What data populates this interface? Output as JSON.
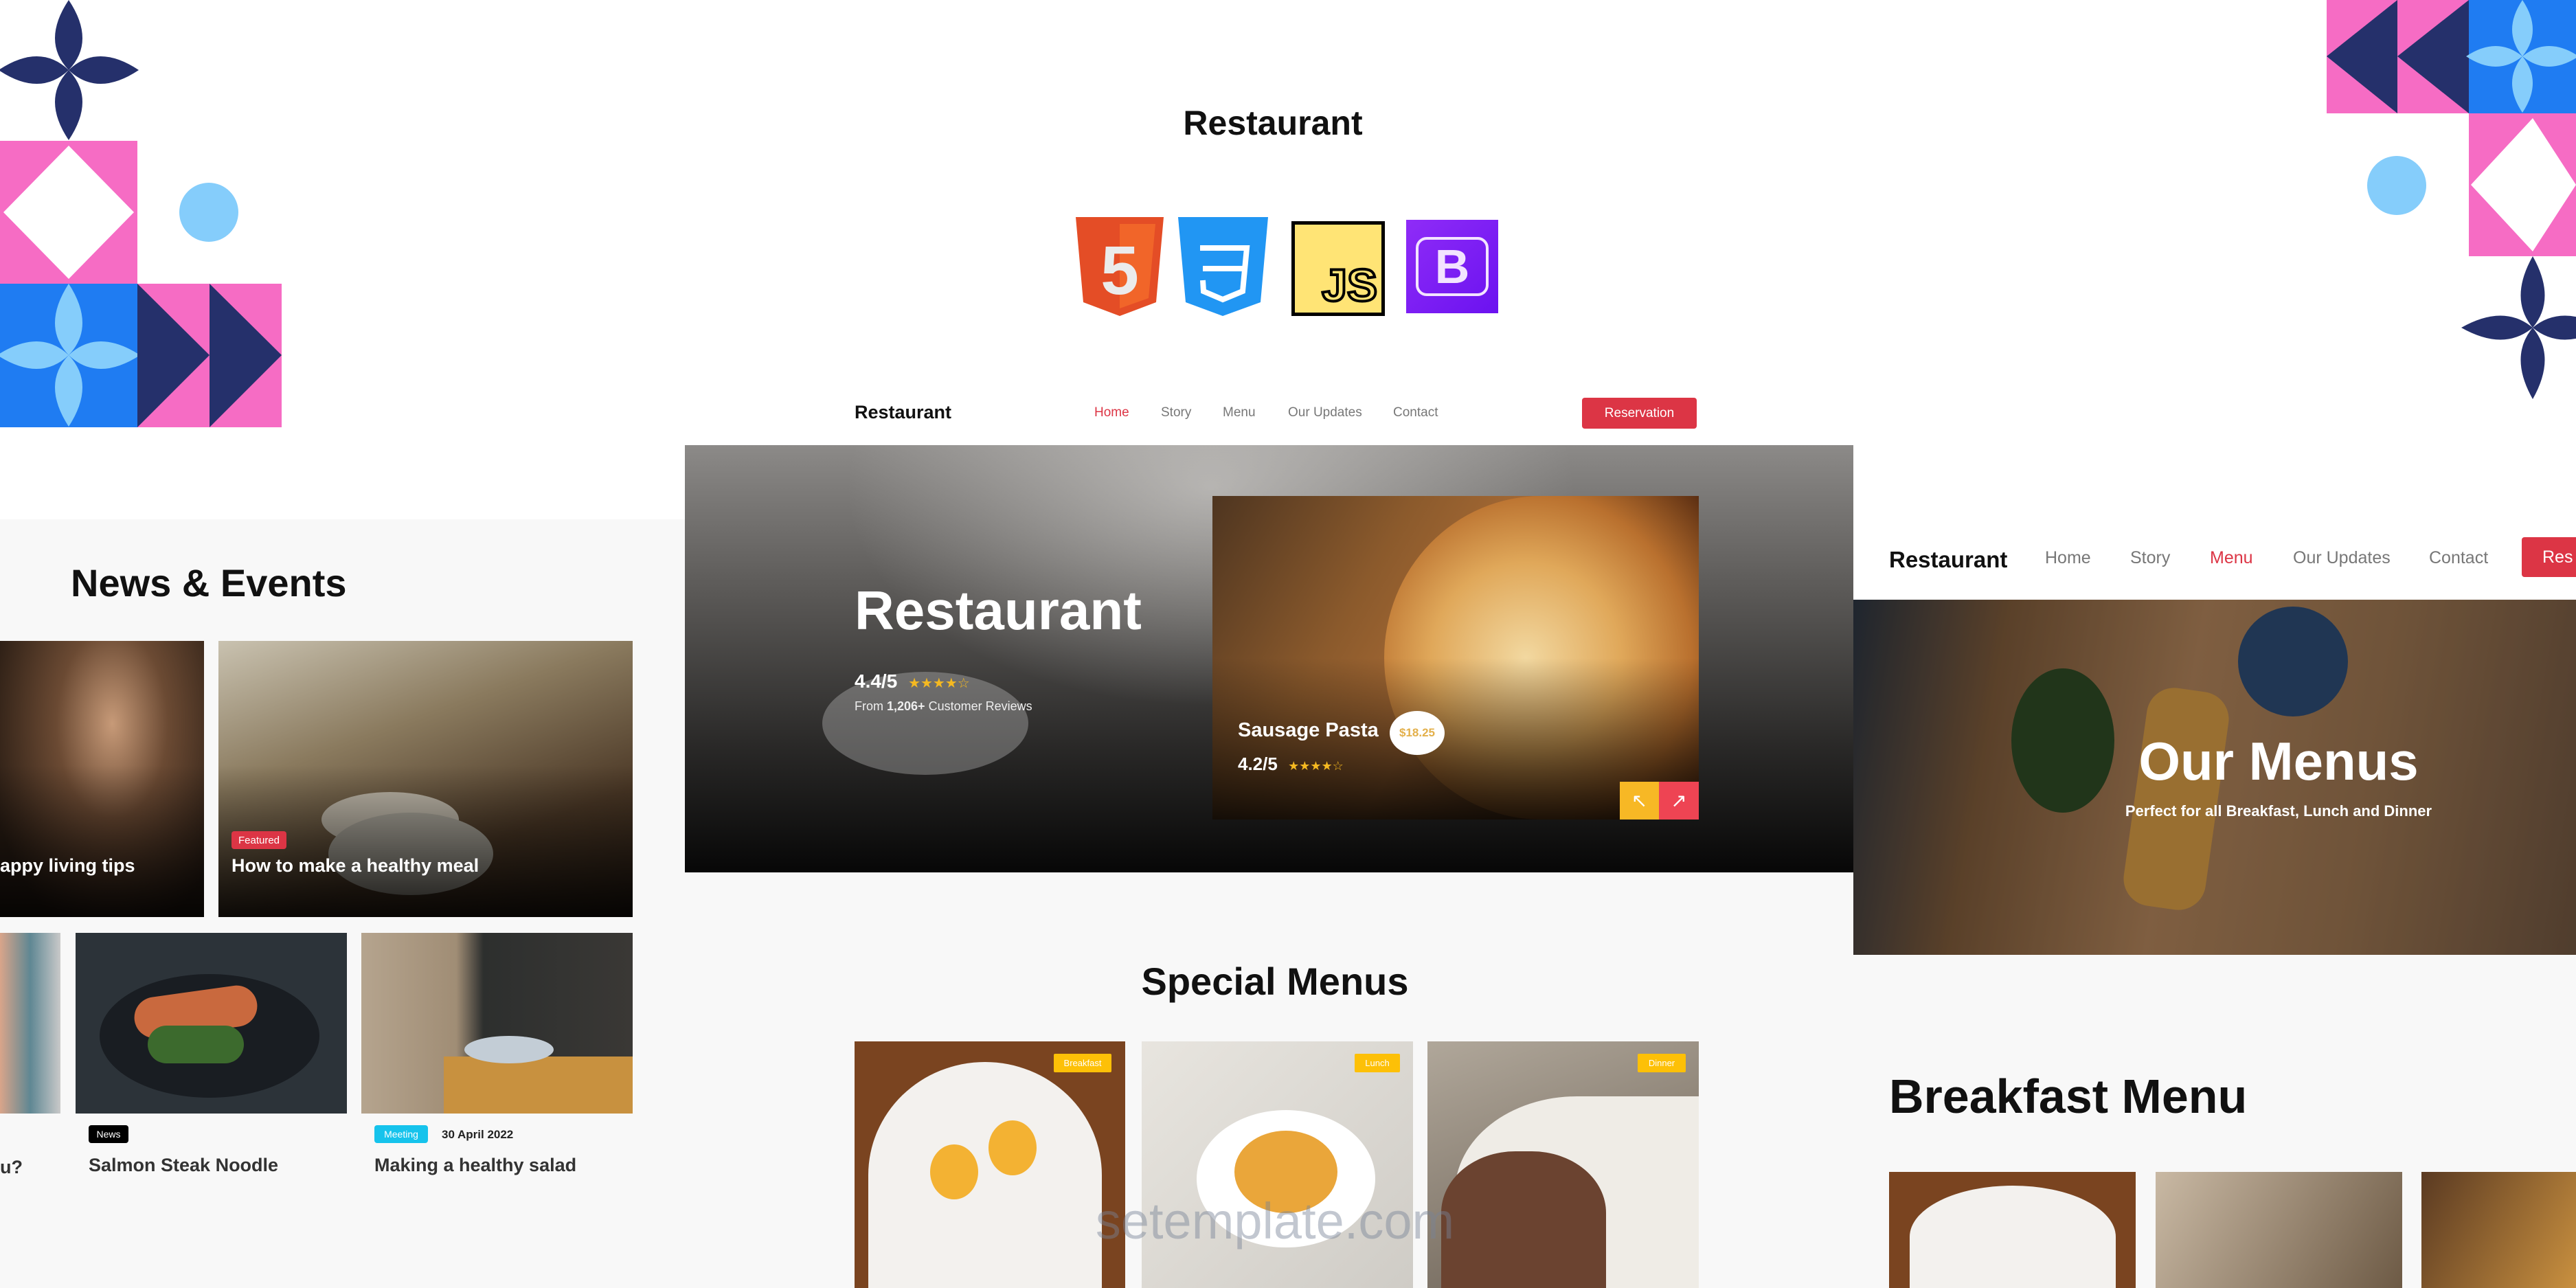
{
  "page_title": "Restaurant",
  "tech_logos": [
    {
      "name": "html5-logo",
      "label": "5",
      "color": "#e44d26"
    },
    {
      "name": "css3-logo",
      "label": "3",
      "color": "#2196f3"
    },
    {
      "name": "javascript-logo",
      "label": "JS",
      "color": "#ffe475"
    },
    {
      "name": "bootstrap-logo",
      "label": "B",
      "color": "#7a1df5"
    }
  ],
  "colors": {
    "accent": "#dc3545",
    "pink": "#f66cc4",
    "navy": "#25306b",
    "blue": "#1f7cf2",
    "light_blue": "#85cdfb",
    "yellow": "#f7b825",
    "cyan": "#16c3ec"
  },
  "home_mockup": {
    "brand": "Restaurant",
    "nav": [
      "Home",
      "Story",
      "Menu",
      "Our Updates",
      "Contact"
    ],
    "active_nav": "Home",
    "reservation_label": "Reservation",
    "hero_title": "Restaurant",
    "rating": "4.4/5",
    "rating_stars": 4,
    "reviews_prefix": "From",
    "reviews_count": "1,206+",
    "reviews_suffix": "Customer Reviews",
    "featured_dish": {
      "name": "Sausage Pasta",
      "price": "$18.25",
      "rating": "4.2/5",
      "rating_stars": 4
    },
    "prev_icon": "↖",
    "next_icon": "↗",
    "special_title": "Special Menus",
    "special_cards": [
      {
        "tag": "Breakfast"
      },
      {
        "tag": "Lunch"
      },
      {
        "tag": "Dinner"
      }
    ]
  },
  "news_mockup": {
    "title": "News & Events",
    "featured": [
      {
        "title": "appy living tips"
      },
      {
        "tag": "Featured",
        "title": "How to make a healthy meal"
      }
    ],
    "posts": [
      {
        "title": "u?"
      },
      {
        "tag": "News",
        "title": "Salmon Steak Noodle"
      },
      {
        "tag": "Meeting",
        "date": "30 April 2022",
        "title": "Making a healthy salad"
      }
    ]
  },
  "menu_mockup": {
    "brand": "Restaurant",
    "nav": [
      "Home",
      "Story",
      "Menu",
      "Our Updates",
      "Contact"
    ],
    "active_nav": "Menu",
    "reservation_label": "Res",
    "hero_title": "Our Menus",
    "hero_subtitle": "Perfect for all Breakfast, Lunch and Dinner",
    "section_title": "Breakfast Menu"
  },
  "watermark": "setemplate.com"
}
